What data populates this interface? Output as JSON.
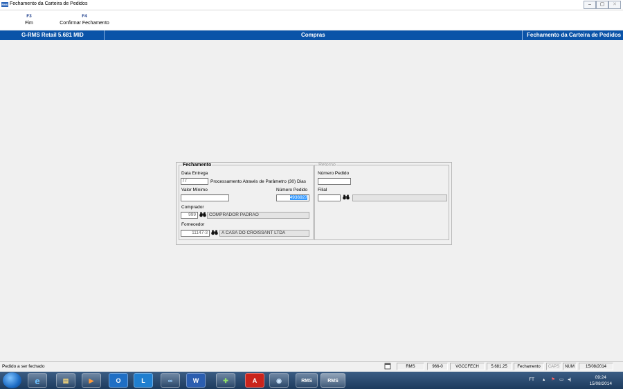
{
  "window": {
    "title": "Fechamento da Carteira de Pedidos",
    "app_icon": "RMS",
    "controls": {
      "minimize": "–",
      "maximize": "▢",
      "close": "✕"
    }
  },
  "fkeys": [
    {
      "key": "F3",
      "label": "Fim"
    },
    {
      "key": "F4",
      "label": "Confirmar Fechamento"
    }
  ],
  "infobar": {
    "system": "G-RMS Retail 5.681 MID",
    "module": "Compras",
    "screen": "Fechamento da Carteira de Pedidos"
  },
  "fechamento": {
    "legend": "Fechamento",
    "data_entrega_label": "Data Entrega",
    "data_entrega_value": "/ /",
    "processamento_text": "Processamento Através de Parâmetro (30) Dias",
    "valor_minimo_label": "Valor Mínimo",
    "valor_minimo_value": "",
    "numero_pedido_label": "Número Pedido",
    "numero_pedido_value": "4936927",
    "comprador_label": "Comprador",
    "comprador_code": "999",
    "comprador_name": "COMPRADOR PADRAO",
    "fornecedor_label": "Fornecedor",
    "fornecedor_code": "11147-3",
    "fornecedor_name": "A CASA DO CROISSANT LTDA"
  },
  "retorno": {
    "legend": "Retorno",
    "numero_pedido_label": "Número Pedido",
    "numero_pedido_value": "",
    "filial_label": "Filial",
    "filial_value": "",
    "filial_name": ""
  },
  "statusbar": {
    "message": "Pedido a ser fechado",
    "cells": [
      "RMS",
      "966-0",
      "VGCCFECH",
      "5.681.25",
      "Fechamento",
      "CAPS",
      "NUM",
      "15/08/2014"
    ]
  },
  "taskbar": {
    "apps": [
      "e",
      "▤",
      "▶",
      "O",
      "L",
      "∞",
      "W",
      "✚",
      "A",
      "◉",
      "RMS",
      "RMS"
    ],
    "tray_label": "FT",
    "clock_time": "09:24",
    "clock_date": "15/08/2014"
  },
  "colors": {
    "infobar_bg": "#0a53a8",
    "selection": "#3399ff"
  }
}
